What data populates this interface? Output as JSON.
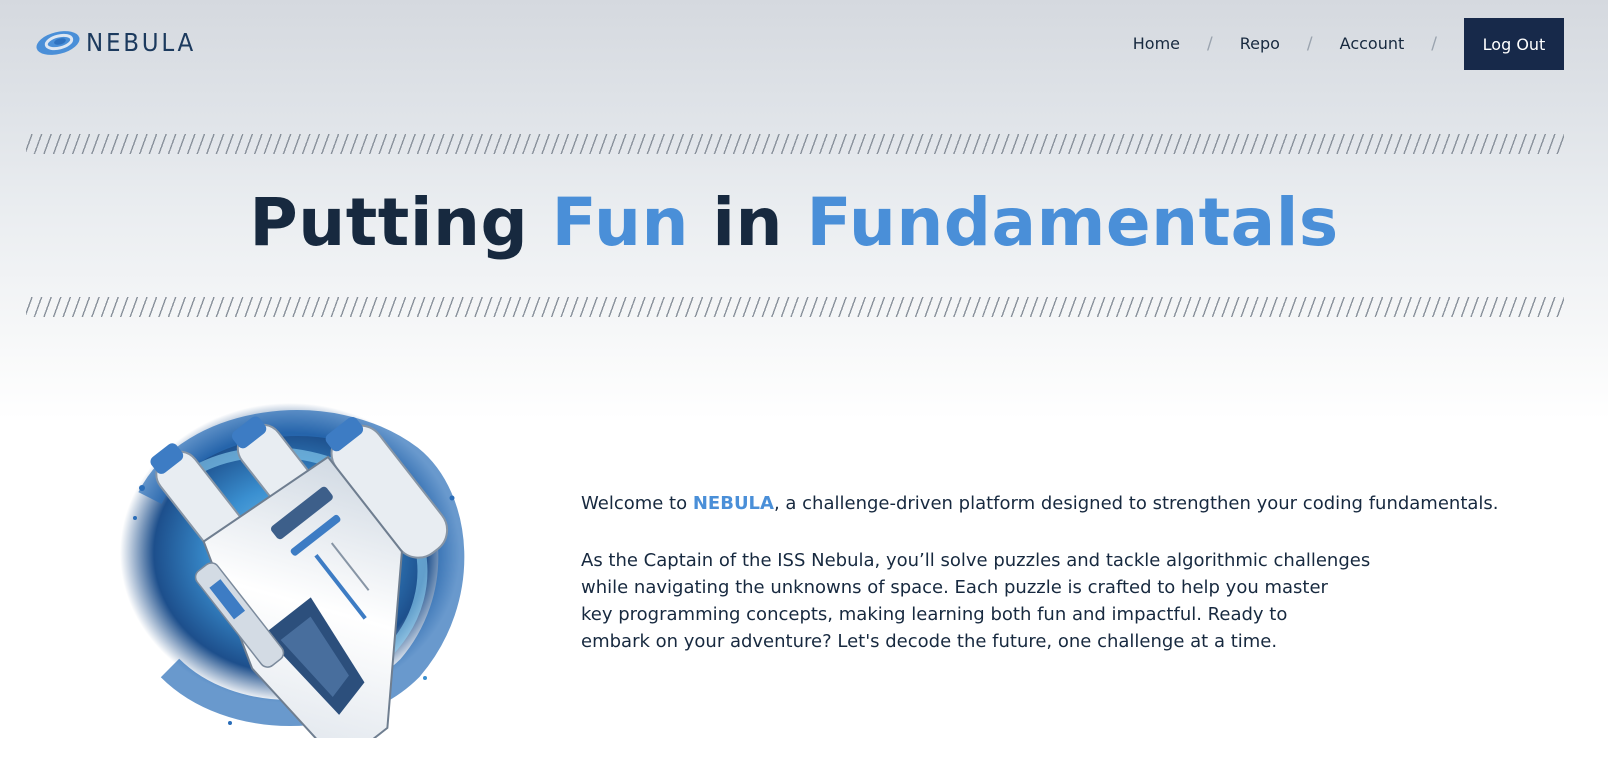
{
  "header": {
    "logo_text": "NEBULA",
    "nav": [
      {
        "label": "Home"
      },
      {
        "label": "Repo"
      },
      {
        "label": "Account"
      }
    ],
    "separator": "/",
    "logout_label": "Log Out"
  },
  "hero": {
    "title_parts": [
      "Putting ",
      "Fun",
      " in ",
      "Fundamentals"
    ]
  },
  "content": {
    "ship_image": "spaceship-illustration",
    "intro": {
      "before": "Welcome to ",
      "brand": "NEBULA",
      "after": ", a challenge-driven platform designed to strengthen your coding fundamentals."
    },
    "body_lines": [
      "As the Captain of the ISS Nebula, you’ll solve puzzles and tackle algorithmic challenges",
      "while navigating the unknowns of space. Each puzzle is crafted to help you master",
      "key programming concepts, making learning both fun and impactful. Ready to",
      "embark on your adventure? Let's decode the future, one challenge at a time."
    ]
  },
  "colors": {
    "primary": "#17293f",
    "accent": "#4a8fd8",
    "button_bg": "#17294a"
  }
}
